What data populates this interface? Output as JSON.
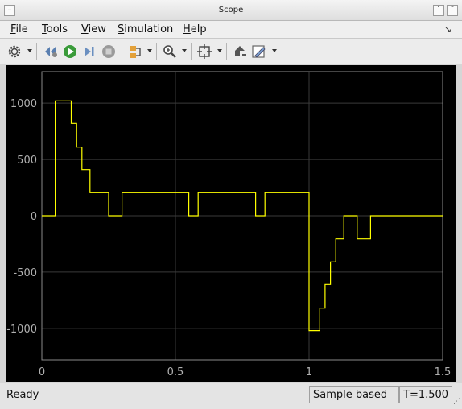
{
  "window": {
    "title": "Scope"
  },
  "menu": [
    {
      "label": "File",
      "ul": "F",
      "rest": "ile"
    },
    {
      "label": "Tools",
      "ul": "T",
      "rest": "ools"
    },
    {
      "label": "View",
      "ul": "V",
      "rest": "iew"
    },
    {
      "label": "Simulation",
      "ul": "S",
      "rest": "imulation"
    },
    {
      "label": "Help",
      "ul": "H",
      "rest": "elp"
    }
  ],
  "toolbar_icons": [
    "gear-icon",
    "step-back-icon",
    "run-icon",
    "step-forward-icon",
    "stop-icon",
    "signal-select-icon",
    "zoom-icon",
    "autoscale-icon",
    "highlight-icon",
    "style-icon"
  ],
  "status": {
    "text": "Ready",
    "mode": "Sample based",
    "time": "T=1.500"
  },
  "colors": {
    "background": "#000000",
    "grid": "#3a3a3a",
    "trace": "#ffff00",
    "ticks": "#b0b0b0"
  },
  "chart_data": {
    "type": "line",
    "style": "step",
    "xlim": [
      0,
      1.5
    ],
    "ylim": [
      -1280,
      1280
    ],
    "xticks": [
      "0",
      "0.5",
      "1",
      "1.5"
    ],
    "xtick_values": [
      0,
      0.5,
      1,
      1.5
    ],
    "yticks": [
      "1000",
      "500",
      "0",
      "-500",
      "-1000"
    ],
    "ytick_values": [
      1000,
      500,
      0,
      -500,
      -1000
    ],
    "grid": true,
    "series": [
      {
        "color": "#ffff00",
        "x": [
          0,
          0.05,
          0.11,
          0.13,
          0.15,
          0.18,
          0.25,
          0.3,
          0.55,
          0.585,
          0.8,
          0.835,
          1.0,
          1.04,
          1.06,
          1.08,
          1.1,
          1.13,
          1.18,
          1.23,
          1.5
        ],
        "y": [
          0,
          1020,
          820,
          610,
          410,
          205,
          0,
          205,
          0,
          205,
          0,
          205,
          -1020,
          -820,
          -610,
          -410,
          -205,
          0,
          -205,
          0,
          0
        ]
      }
    ]
  }
}
